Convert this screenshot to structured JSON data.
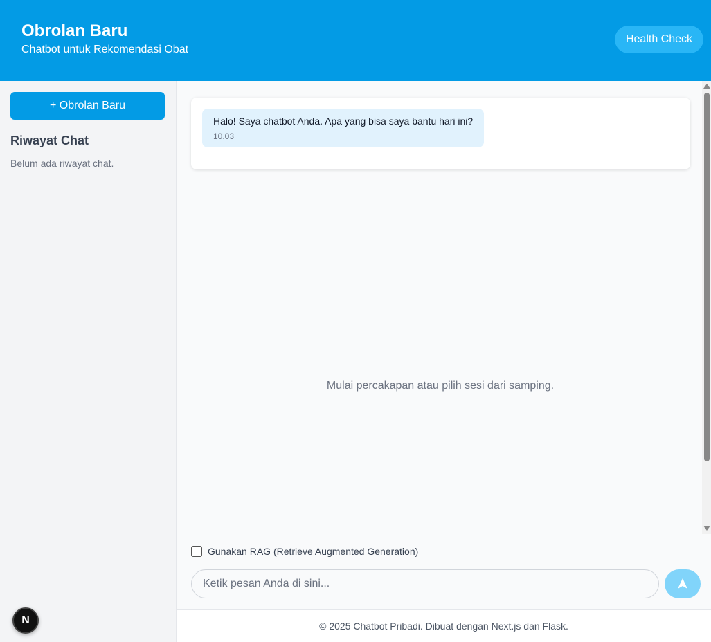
{
  "header": {
    "title": "Obrolan Baru",
    "subtitle": "Chatbot untuk Rekomendasi Obat",
    "health_check_label": "Health Check"
  },
  "sidebar": {
    "new_chat_label": "+ Obrolan Baru",
    "history_title": "Riwayat Chat",
    "history_empty": "Belum ada riwayat chat.",
    "badge_letter": "N"
  },
  "chat": {
    "messages": [
      {
        "text": "Halo! Saya chatbot Anda. Apa yang bisa saya bantu hari ini?",
        "time": "10.03"
      }
    ],
    "empty_text": "Mulai percakapan atau pilih sesi dari samping."
  },
  "composer": {
    "rag_label": "Gunakan RAG (Retrieve Augmented Generation)",
    "rag_checked": false,
    "input_value": "",
    "input_placeholder": "Ketik pesan Anda di sini...",
    "send_icon": "send-icon"
  },
  "footer": {
    "text": "© 2025 Chatbot Pribadi. Dibuat dengan Next.js dan Flask."
  },
  "colors": {
    "primary": "#039be5",
    "health_button": "#29b6f6",
    "send_button": "#81d4fa",
    "bubble": "#e1f2fd"
  }
}
